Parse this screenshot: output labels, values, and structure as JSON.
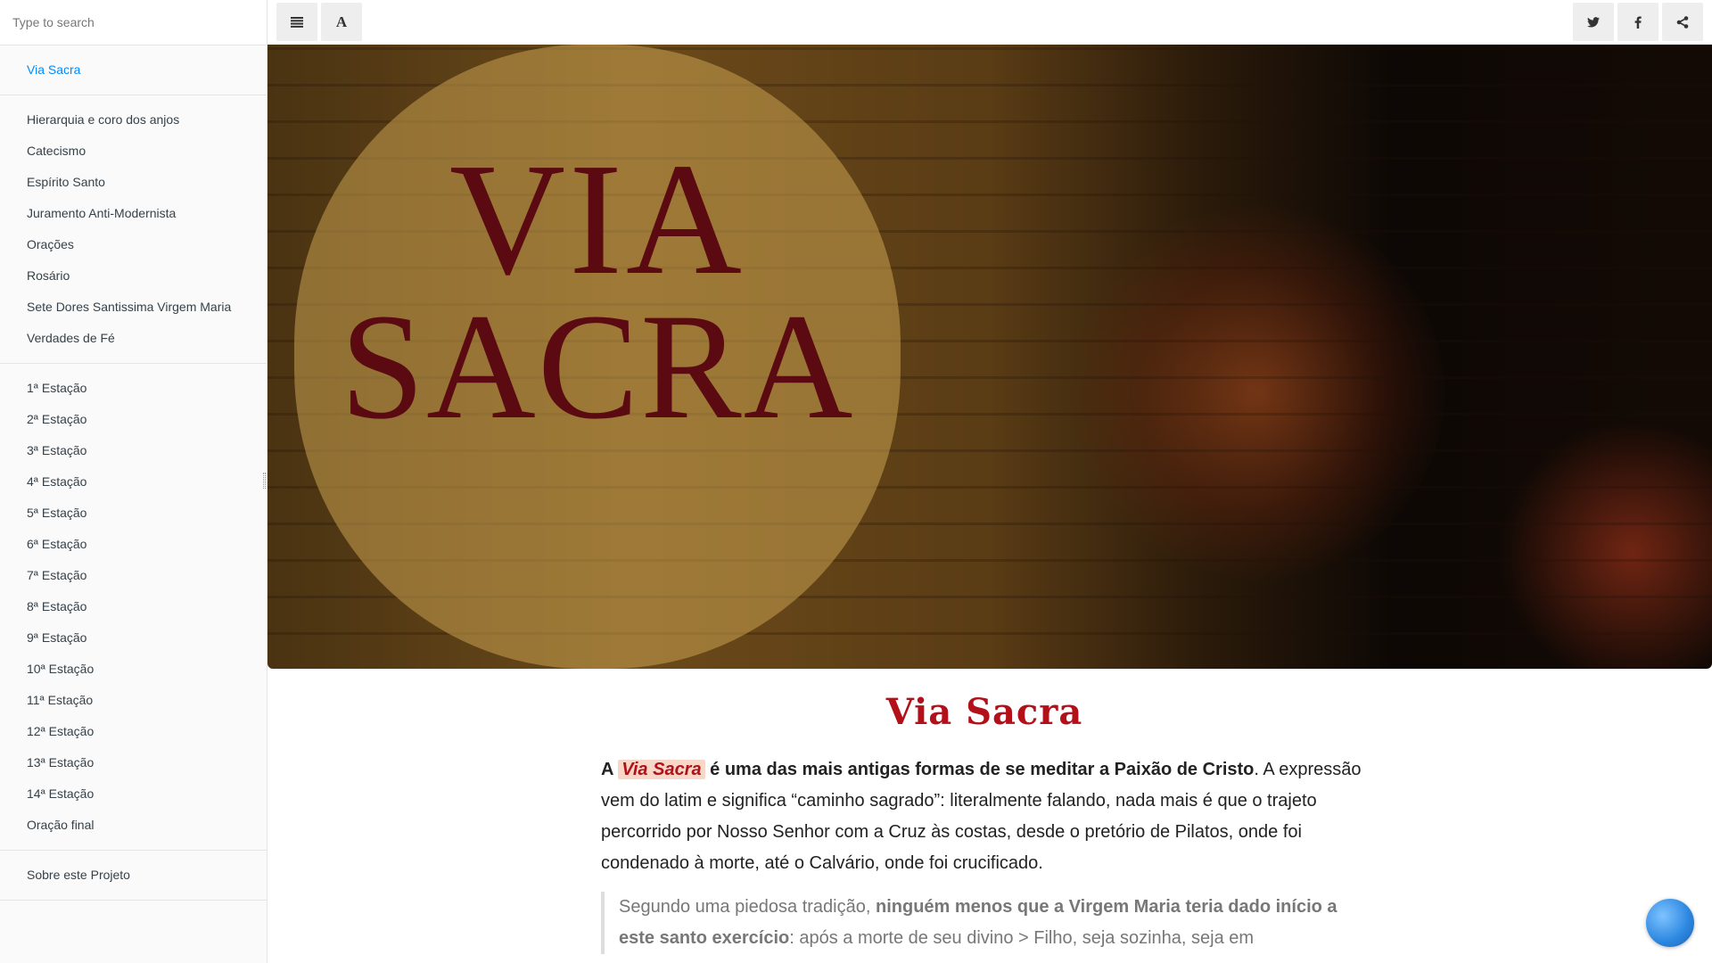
{
  "search": {
    "placeholder": "Type to search"
  },
  "sidebar": {
    "group1": [
      {
        "label": "Via Sacra"
      }
    ],
    "group2": [
      {
        "label": "Hierarquia e coro dos anjos"
      },
      {
        "label": "Catecismo"
      },
      {
        "label": "Espírito Santo"
      },
      {
        "label": "Juramento Anti-Modernista"
      },
      {
        "label": "Orações"
      },
      {
        "label": "Rosário"
      },
      {
        "label": "Sete Dores Santissima Virgem Maria"
      },
      {
        "label": "Verdades de Fé"
      }
    ],
    "group3": [
      {
        "label": "1ª Estação"
      },
      {
        "label": "2ª Estação"
      },
      {
        "label": "3ª Estação"
      },
      {
        "label": "4ª Estação"
      },
      {
        "label": "5ª Estação"
      },
      {
        "label": "6ª Estação"
      },
      {
        "label": "7ª Estação"
      },
      {
        "label": "8ª Estação"
      },
      {
        "label": "9ª Estação"
      },
      {
        "label": "10ª Estação"
      },
      {
        "label": "11ª Estação"
      },
      {
        "label": "12ª Estação"
      },
      {
        "label": "13ª Estação"
      },
      {
        "label": "14ª Estação"
      },
      {
        "label": "Oração final"
      }
    ],
    "group4": [
      {
        "label": "Sobre este Projeto"
      }
    ]
  },
  "toolbar": {
    "font_label": "A"
  },
  "banner": {
    "line1": "VIA",
    "line2": "SACRA"
  },
  "page": {
    "title": "Via Sacra",
    "p1_a": "A ",
    "p1_hl": "Via Sacra",
    "p1_bold": " é uma das mais antigas formas de se meditar a Paixão de Cristo",
    "p1_rest": ". A expressão vem do latim e significa “caminho sagrado”: literalmente falando, nada mais é que o trajeto percorrido por Nosso Senhor com a Cruz às costas, desde o pretório de Pilatos, onde foi condenado à morte, até o Calvário, onde foi crucificado.",
    "q_a": "Segundo uma piedosa tradição, ",
    "q_bold": "ninguém menos que a Virgem Maria teria dado início a este santo exercício",
    "q_rest": ": após a morte de seu divino > Filho, seja sozinha, seja em"
  },
  "colors": {
    "active_link": "#008cff",
    "title_red": "#b3111a",
    "highlight_bg": "#f6d7c8"
  }
}
